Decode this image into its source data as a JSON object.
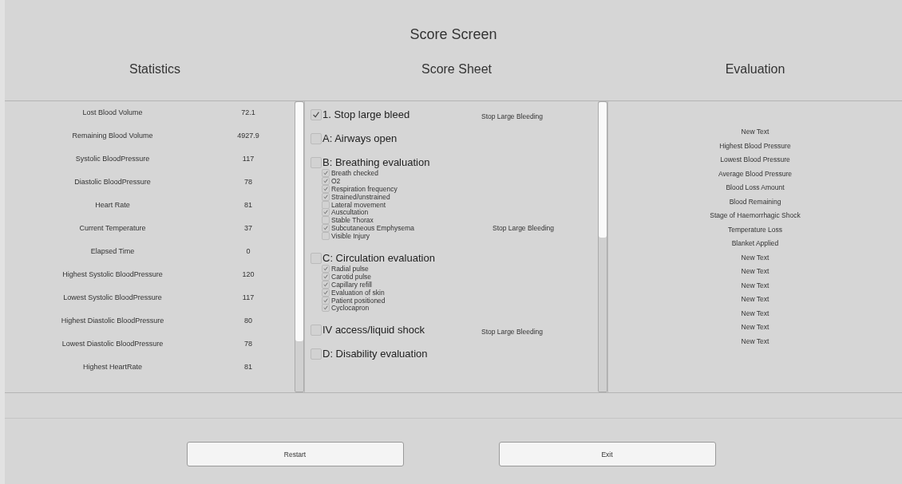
{
  "window": {
    "title": "Score Screen"
  },
  "statistics": {
    "heading": "Statistics",
    "rows": [
      {
        "label": "Lost Blood Volume",
        "value": "72.1"
      },
      {
        "label": "Remaining Blood Volume",
        "value": "4927.9"
      },
      {
        "label": "Systolic BloodPressure",
        "value": "117"
      },
      {
        "label": "Diastolic BloodPressure",
        "value": "78"
      },
      {
        "label": "Heart Rate",
        "value": "81"
      },
      {
        "label": "Current Temperature",
        "value": "37"
      },
      {
        "label": "Elapsed Time",
        "value": "0"
      },
      {
        "label": "Highest Systolic BloodPressure",
        "value": "120"
      },
      {
        "label": "Lowest Systolic BloodPressure",
        "value": "117"
      },
      {
        "label": "Highest Diastolic BloodPressure",
        "value": "80"
      },
      {
        "label": "Lowest Diastolic BloodPressure",
        "value": "78"
      },
      {
        "label": "Highest HeartRate",
        "value": "81"
      }
    ]
  },
  "score_sheet": {
    "heading": "Score Sheet",
    "sections": [
      {
        "label": "1. Stop large bleed",
        "checked": true,
        "note": "Stop Large Bleeding"
      },
      {
        "label": "A: Airways open",
        "checked": false
      },
      {
        "label": "B: Breathing evaluation",
        "checked": false,
        "items": [
          {
            "label": "Breath checked",
            "checked": true
          },
          {
            "label": "O2",
            "checked": true
          },
          {
            "label": "Respiration frequency",
            "checked": true
          },
          {
            "label": "Strained/unstrained",
            "checked": true
          },
          {
            "label": "Lateral movement",
            "checked": false
          },
          {
            "label": "Auscultation",
            "checked": true
          },
          {
            "label": "Stable Thorax",
            "checked": false
          },
          {
            "label": "Subcutaneous Emphysema",
            "checked": true,
            "note": "Stop Large Bleeding"
          },
          {
            "label": "Visible Injury",
            "checked": false
          }
        ]
      },
      {
        "label": "C: Circulation evaluation",
        "checked": false,
        "items": [
          {
            "label": "Radial pulse",
            "checked": true
          },
          {
            "label": "Carotid pulse",
            "checked": true
          },
          {
            "label": "Capillary refill",
            "checked": true
          },
          {
            "label": "Evaluation of skin",
            "checked": true
          },
          {
            "label": "Patient positioned",
            "checked": true
          },
          {
            "label": "Cyclocapron",
            "checked": true
          }
        ]
      },
      {
        "label": "IV access/liquid shock",
        "checked": false,
        "note": "Stop Large Bleeding"
      },
      {
        "label": "D: Disability evaluation",
        "checked": false
      }
    ]
  },
  "evaluation": {
    "heading": "Evaluation",
    "lines": [
      "New Text",
      "Highest Blood Pressure",
      "Lowest Blood Pressure",
      "Average Blood Pressure",
      "Blood Loss Amount",
      "Blood Remaining",
      "Stage of Haemorrhagic Shock",
      "Temperature Loss",
      "Blanket Applied",
      "New Text",
      "New Text",
      "New Text",
      "New Text",
      "New Text",
      "New Text",
      "New Text"
    ]
  },
  "buttons": [
    "Restart",
    "Exit"
  ]
}
